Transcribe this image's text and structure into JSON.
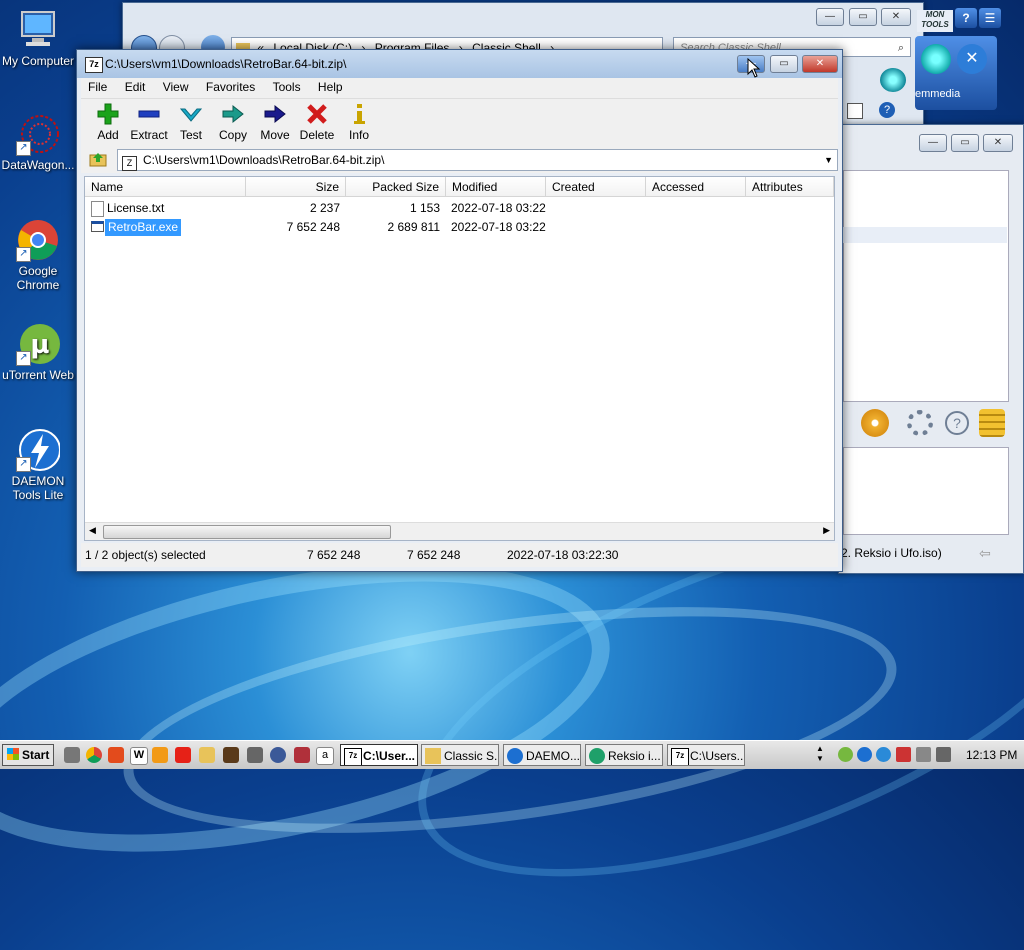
{
  "desktop": {
    "icons": [
      {
        "label": "My Computer"
      },
      {
        "label": "DataWagon..."
      },
      {
        "label": "Google Chrome"
      },
      {
        "label": "uTorrent Web"
      },
      {
        "label": "DAEMON Tools Lite"
      }
    ]
  },
  "explorer_window": {
    "breadcrumb": [
      "«",
      "Local Disk (C:)",
      "›",
      "Program Files",
      "›",
      "Classic Shell",
      "›"
    ],
    "search_placeholder": "Search Classic Shell"
  },
  "daemon_window": {
    "logo_text": "MON TOOLS",
    "tab_label": "emmedia",
    "status_text": "2. Reksio i Ufo.iso)"
  },
  "sevenzip": {
    "title": "C:\\Users\\vm1\\Downloads\\RetroBar.64-bit.zip\\",
    "title_icon": "7z",
    "menu": [
      "File",
      "Edit",
      "View",
      "Favorites",
      "Tools",
      "Help"
    ],
    "toolbar": [
      {
        "label": "Add",
        "icon": "plus-icon",
        "color": "#1aa31a"
      },
      {
        "label": "Extract",
        "icon": "minus-icon",
        "color": "#1f3fbf"
      },
      {
        "label": "Test",
        "icon": "check-icon",
        "color": "#19a9c6"
      },
      {
        "label": "Copy",
        "icon": "copy-arrow-icon",
        "color": "#1b9a8a"
      },
      {
        "label": "Move",
        "icon": "move-arrow-icon",
        "color": "#1a1a8c"
      },
      {
        "label": "Delete",
        "icon": "delete-x-icon",
        "color": "#d11c1c"
      },
      {
        "label": "Info",
        "icon": "info-icon",
        "color": "#c9a400"
      }
    ],
    "address": "C:\\Users\\vm1\\Downloads\\RetroBar.64-bit.zip\\",
    "columns": [
      "Name",
      "Size",
      "Packed Size",
      "Modified",
      "Created",
      "Accessed",
      "Attributes"
    ],
    "rows": [
      {
        "name": "License.txt",
        "size": "2 237",
        "packed": "1 153",
        "modified": "2022-07-18 03:22",
        "selected": false
      },
      {
        "name": "RetroBar.exe",
        "size": "7 652 248",
        "packed": "2 689 811",
        "modified": "2022-07-18 03:22",
        "selected": true
      }
    ],
    "status": {
      "selection": "1 / 2 object(s) selected",
      "size": "7 652 248",
      "packed": "7 652 248",
      "modified": "2022-07-18 03:22:30"
    }
  },
  "taskbar": {
    "start_label": "Start",
    "buttons": [
      {
        "label": "C:\\User..."
      },
      {
        "label": "Classic S..."
      },
      {
        "label": "DAEMO..."
      },
      {
        "label": "Reksio i..."
      },
      {
        "label": "C:\\Users..."
      }
    ],
    "clock": "12:13 PM"
  },
  "colors": {
    "selection": "#3399ff",
    "titlebar": "#a9c4e4"
  }
}
